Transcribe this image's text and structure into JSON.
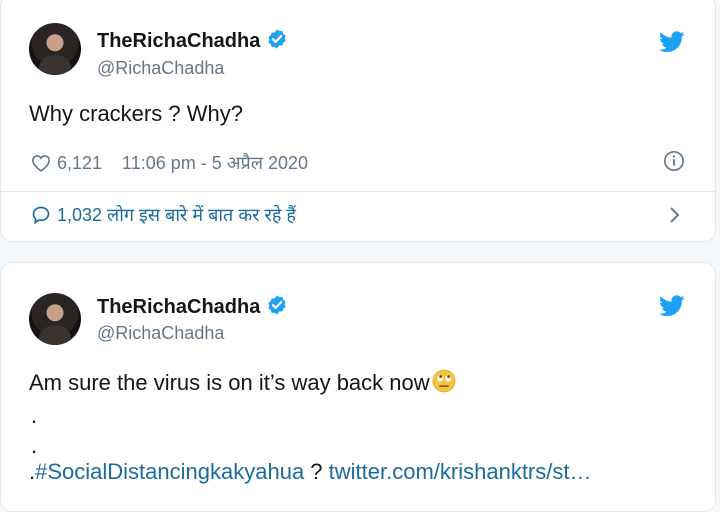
{
  "tweets": [
    {
      "display_name": "TheRichaChadha",
      "handle": "@RichaChadha",
      "text": "Why crackers ? Why?",
      "likes": "6,121",
      "timestamp": "11:06 pm - 5 अप्रैल 2020",
      "replies_text": "1,032 लोग इस बारे में बात कर रहे हैं"
    },
    {
      "display_name": "TheRichaChadha",
      "handle": "@RichaChadha",
      "text": "Am sure the virus is on it’s way back now",
      "dot1": ".",
      "dot2": ".",
      "line3_prefix": ".",
      "hashtag": "#SocialDistancingkakyahua",
      "line3_mid": " ? ",
      "link": "twitter.com/krishanktrs/st…"
    }
  ],
  "colors": {
    "verified": "#1da1f2",
    "twitter_bird": "#1da1f2",
    "link": "#1b6b9c",
    "secondary_text": "#657786"
  },
  "icons": [
    "verified-badge-icon",
    "twitter-bird-icon",
    "heart-icon",
    "info-icon",
    "reply-bubble-icon",
    "chevron-right-icon",
    "face-with-rolling-eyes-emoji"
  ]
}
